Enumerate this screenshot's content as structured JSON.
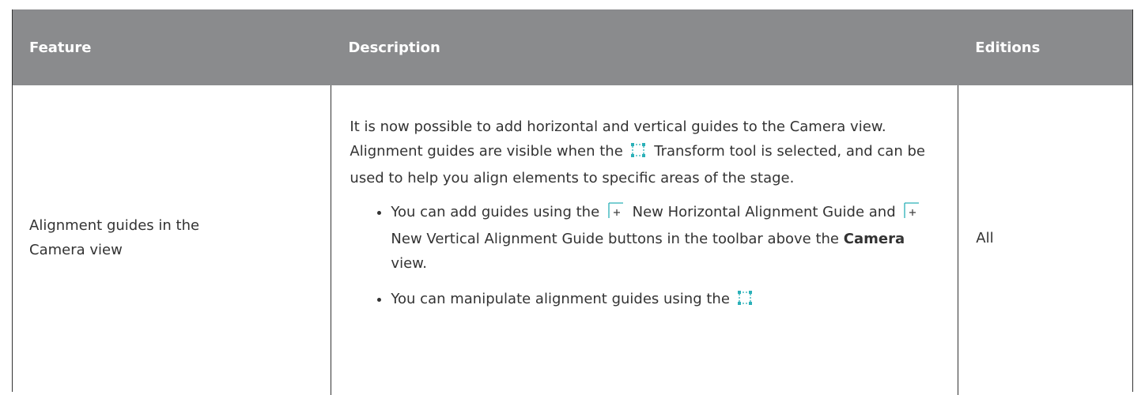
{
  "header": {
    "feature": "Feature",
    "description": "Description",
    "editions": "Editions"
  },
  "row": {
    "feature": "Alignment guides in the Camera view",
    "editions": "All",
    "desc_intro_1": "It is now possible to add horizontal and vertical guides to the Camera view. Alignment guides are visible when the",
    "desc_intro_2": "Transform tool is selected, and can be used to help you align elements to specific areas of the stage.",
    "bullet1_part1": "You can add guides using the",
    "bullet1_part2": "New Horizontal Alignment Guide and",
    "bullet1_part3": "New Vertical Alignment Guide buttons in the toolbar above the",
    "bullet1_bold": "Camera",
    "bullet1_part4": "view.",
    "bullet2_part1": "You can manipulate alignment guides using the"
  },
  "icons": {
    "transform": "transform-tool-icon",
    "h_guide": "new-horizontal-alignment-guide-icon",
    "v_guide": "new-vertical-alignment-guide-icon"
  },
  "colors": {
    "header_bg": "#8a8b8d",
    "icon_accent": "#2ab0b8"
  }
}
